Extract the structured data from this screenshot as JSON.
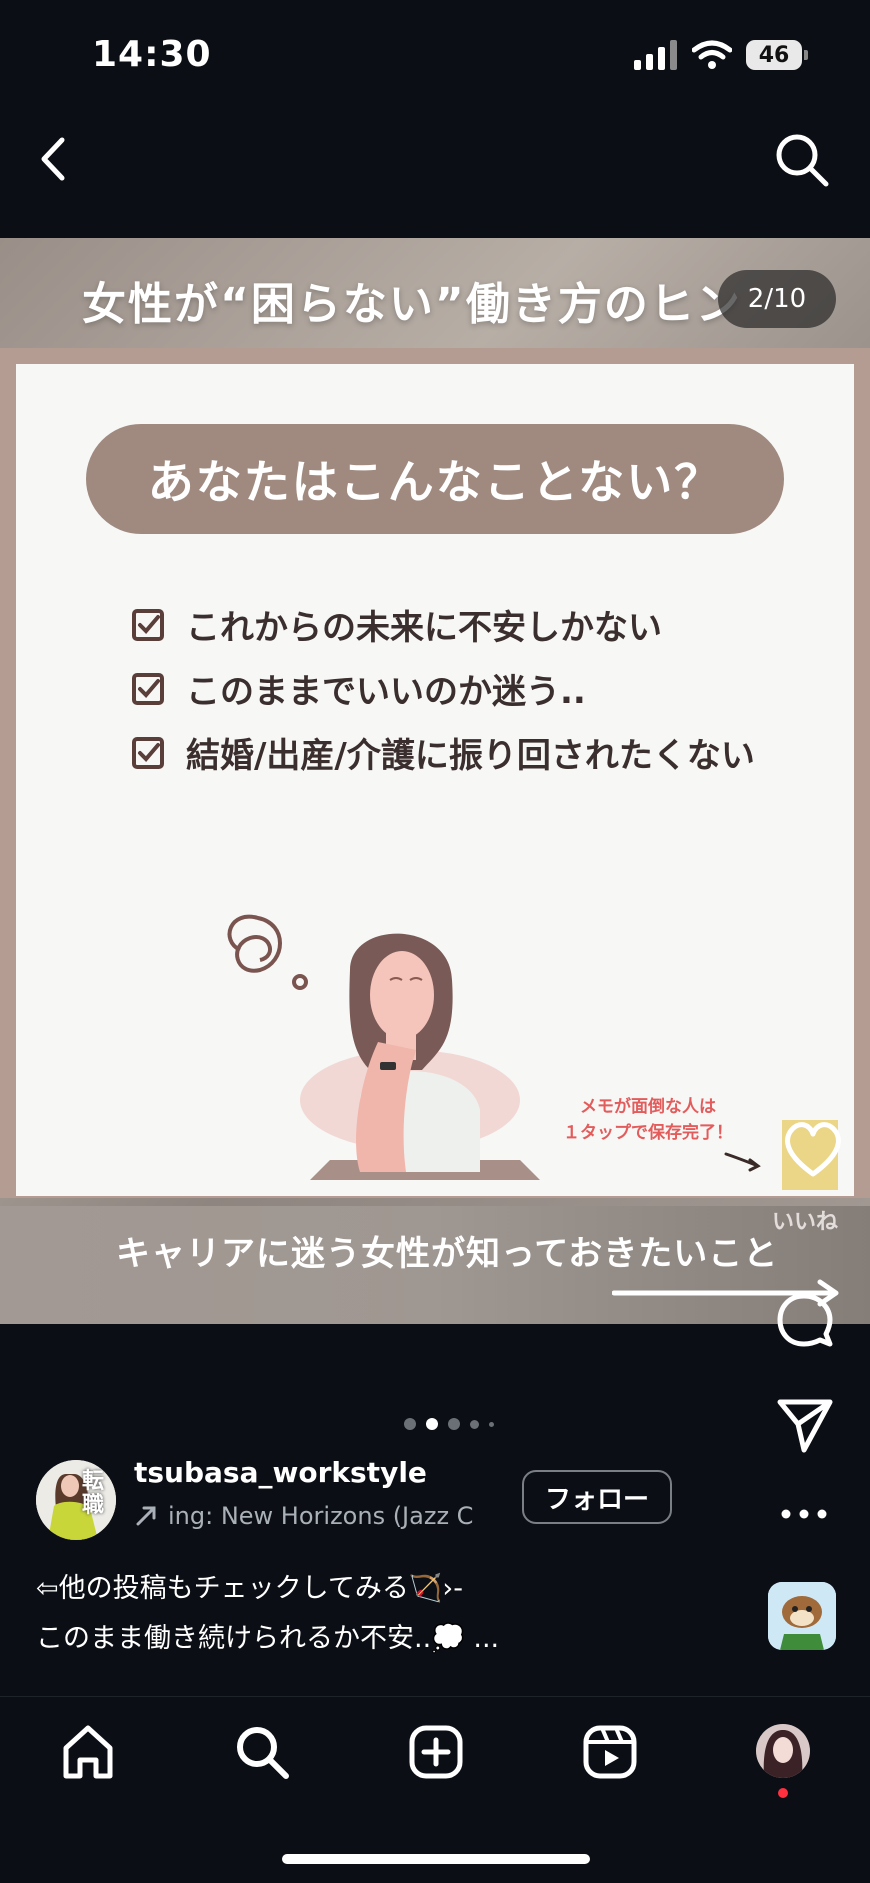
{
  "status_bar": {
    "time": "14:30",
    "battery": "46"
  },
  "post": {
    "slide_title": "女性が“困らない”働き方のヒン",
    "slide_counter": "2/10",
    "question": "あなたはこんなことない？",
    "checklist": [
      "これからの未来に不安しかない",
      "このままでいいのか迷う..",
      "結婚/出産/介護に振り回されたくない"
    ],
    "memo_note_line1": "メモが面倒な人は",
    "memo_note_line2": "１タップで保存完了！",
    "like_label": "いいね",
    "caption_on_image": "キャリアに迷う女性が知っておきたいこと"
  },
  "author": {
    "username": "tsubasa_workstyle",
    "avatar_text": "転職",
    "music": "ing: New Horizons (Jazz C",
    "follow_label": "フォロー"
  },
  "caption": {
    "line1": "⇦他の投稿もチェックしてみる🏹›-",
    "line2": "このまま働き続けられるか不安..💭 ..."
  },
  "icons": {
    "back": "chevron-left-icon",
    "search": "search-icon",
    "comment": "comment-icon",
    "share": "paper-plane-icon",
    "more": "more-icon",
    "home": "home-icon",
    "add": "add-icon",
    "reels": "reels-icon"
  },
  "colors": {
    "background": "#0b0e14",
    "pill": "#a08a80",
    "memo_red": "#e35c5c",
    "notification": "#ff3040"
  }
}
